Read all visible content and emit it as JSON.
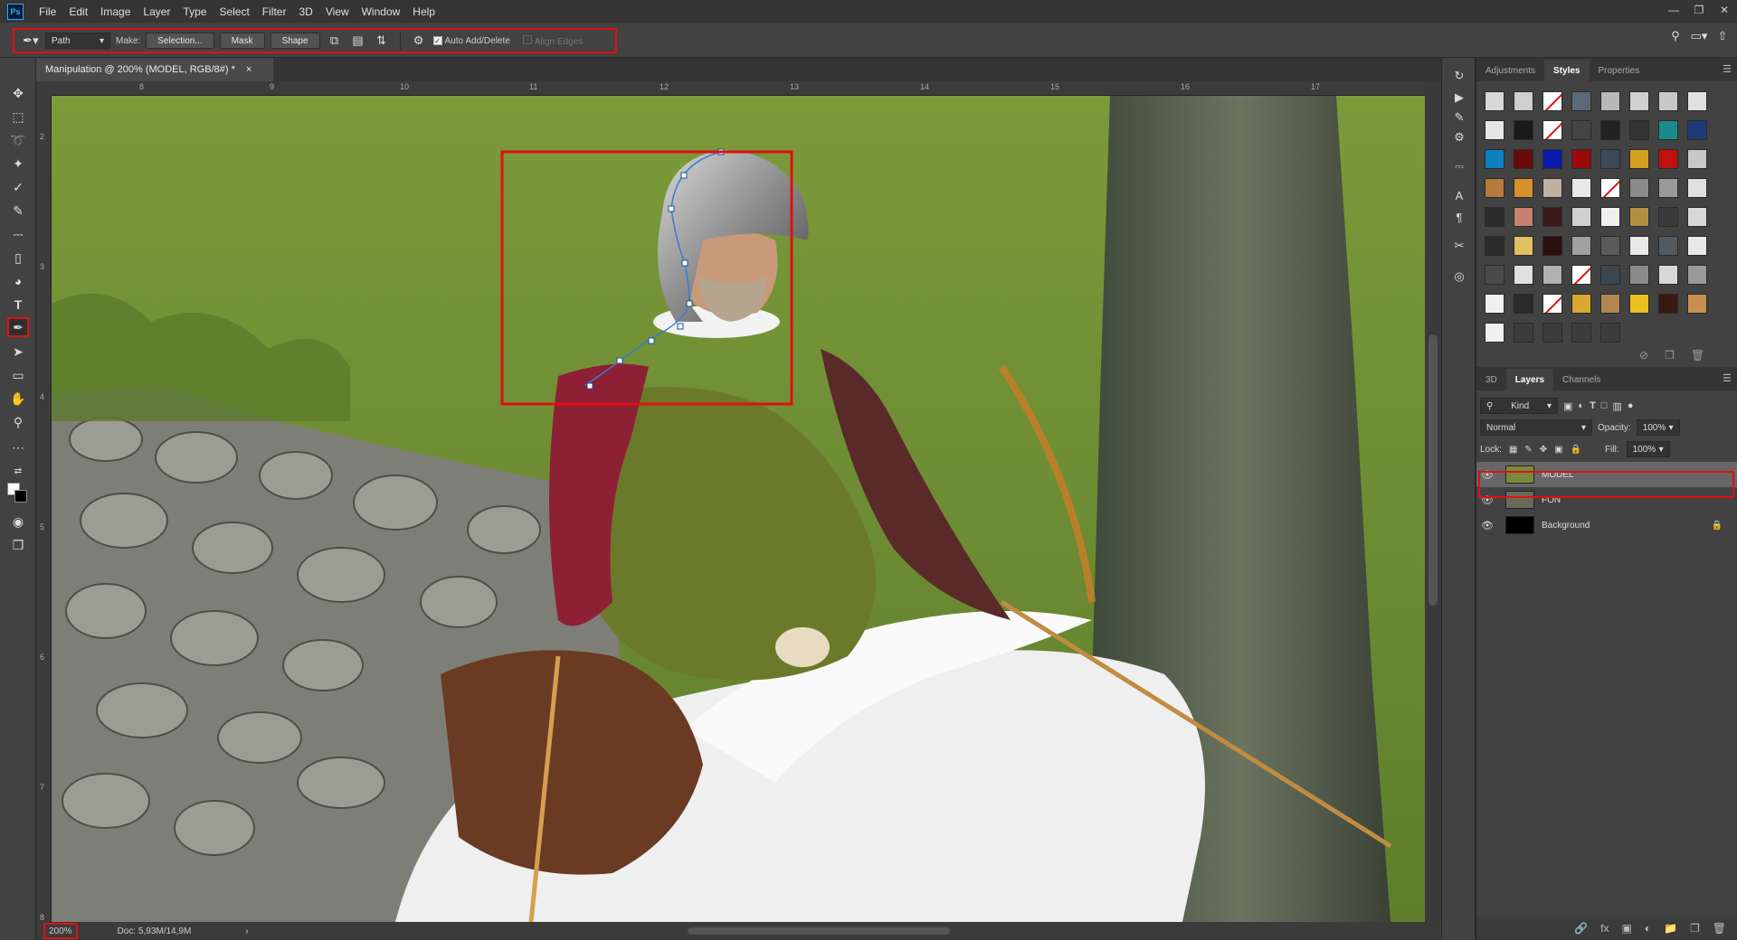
{
  "app": {
    "logo": "Ps",
    "menu": [
      "File",
      "Edit",
      "Image",
      "Layer",
      "Type",
      "Select",
      "Filter",
      "3D",
      "View",
      "Window",
      "Help"
    ]
  },
  "options": {
    "mode": "Path",
    "make_label": "Make:",
    "selection_btn": "Selection...",
    "mask_btn": "Mask",
    "shape_btn": "Shape",
    "auto_add_delete": "Auto Add/Delete",
    "align_edges": "Align Edges"
  },
  "document": {
    "tab_title": "Manipulation @ 200% (MODEL, RGB/8#) *",
    "close": "×"
  },
  "ruler": {
    "h_ticks": [
      "8",
      "9",
      "10",
      "11",
      "12",
      "13",
      "14",
      "15",
      "16",
      "17"
    ],
    "v_ticks": [
      "2",
      "3",
      "4",
      "5",
      "6",
      "7",
      "8"
    ]
  },
  "status": {
    "zoom": "200%",
    "doc_size": "Doc: 5,93M/14,9M",
    "arrow": "›"
  },
  "top_panel": {
    "tabs": [
      "Adjustments",
      "Styles",
      "Properties"
    ],
    "active_tab": "Styles"
  },
  "layers_panel": {
    "tabs": [
      "3D",
      "Layers",
      "Channels"
    ],
    "active_tab": "Layers",
    "filter": "Kind",
    "blend_mode": "Normal",
    "opacity_label": "Opacity:",
    "opacity": "100%",
    "lock_label": "Lock:",
    "fill_label": "Fill:",
    "fill": "100%",
    "layers": [
      {
        "name": "MODEL",
        "active": true
      },
      {
        "name": "FON",
        "active": false
      },
      {
        "name": "Background",
        "active": false,
        "locked": true
      }
    ]
  },
  "colors": {
    "highlight": "#e01010",
    "panel": "#424242",
    "accent": "#31a8ff"
  }
}
